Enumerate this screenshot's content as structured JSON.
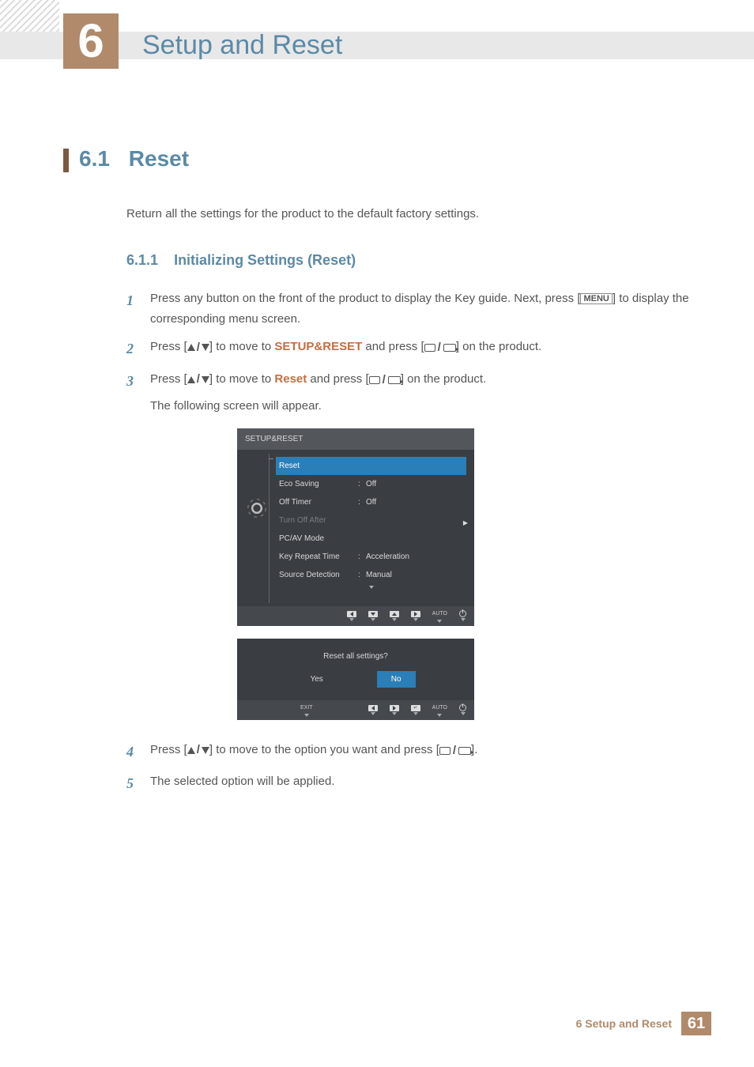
{
  "chapter": {
    "number": "6",
    "title": "Setup and Reset"
  },
  "section": {
    "number": "6.1",
    "title": "Reset",
    "intro": "Return all the settings for the product to the default factory settings."
  },
  "subsection": {
    "number": "6.1.1",
    "title": "Initializing Settings (Reset)"
  },
  "steps": {
    "s1": {
      "num": "1",
      "pre": "Press any button on the front of the product to display the Key guide. Next, press [",
      "menu": "MENU",
      "post": "] to display the corresponding menu screen."
    },
    "s2": {
      "num": "2",
      "pre": "Press [",
      "mid1": "] to move to ",
      "hl": "SETUP&RESET",
      "mid2": " and press [",
      "post": "] on the product."
    },
    "s3": {
      "num": "3",
      "pre": "Press [",
      "mid1": "] to move to ",
      "hl": "Reset",
      "mid2": " and press [",
      "post": "] on the product.",
      "follow": "The following screen will appear."
    },
    "s4": {
      "num": "4",
      "pre": "Press [",
      "mid1": "] to move to the option you want and press [",
      "post": "]."
    },
    "s5": {
      "num": "5",
      "text": "The selected option will be applied."
    }
  },
  "osd": {
    "title": "SETUP&RESET",
    "rows": [
      {
        "label": "Reset",
        "value": "",
        "state": "selected"
      },
      {
        "label": "Eco Saving",
        "value": "Off",
        "state": ""
      },
      {
        "label": "Off Timer",
        "value": "Off",
        "state": ""
      },
      {
        "label": "Turn Off After",
        "value": "",
        "state": "disabled"
      },
      {
        "label": "PC/AV Mode",
        "value": "",
        "state": ""
      },
      {
        "label": "Key Repeat Time",
        "value": "Acceleration",
        "state": ""
      },
      {
        "label": "Source Detection",
        "value": "Manual",
        "state": ""
      }
    ],
    "buttons": {
      "auto": "AUTO",
      "exit": "EXIT"
    }
  },
  "dialog": {
    "question": "Reset all settings?",
    "yes": "Yes",
    "no": "No"
  },
  "footer": {
    "text": "6 Setup and Reset",
    "page": "61"
  }
}
